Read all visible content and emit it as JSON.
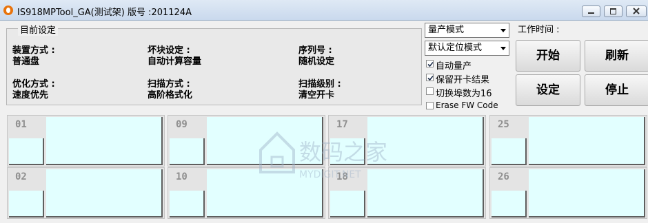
{
  "window": {
    "title": "IS918MPTool_GA(测试架) 版号 :201124A"
  },
  "group": {
    "title": "目前设定",
    "fields": [
      {
        "label": "装置方式 :",
        "value": "普通盘"
      },
      {
        "label": "坏块设定 :",
        "value": "自动计算容量"
      },
      {
        "label": "序列号 :",
        "value": "随机设定"
      },
      {
        "label": "优化方式 :",
        "value": "速度优先"
      },
      {
        "label": "扫描方式 :",
        "value": "高阶格式化"
      },
      {
        "label": "扫描级别 :",
        "value": "清空开卡"
      }
    ]
  },
  "controls": {
    "mode_select": "量产模式",
    "position_select": "默认定位模式",
    "checkboxes": [
      {
        "label": "自动量产",
        "checked": true
      },
      {
        "label": "保留开卡结果",
        "checked": true
      },
      {
        "label": "切换埠数为16",
        "checked": false
      },
      {
        "label": "Erase FW Code",
        "checked": false
      }
    ],
    "work_time_label": "工作时间 :",
    "buttons": {
      "start": "开始",
      "refresh": "刷新",
      "settings": "设定",
      "stop": "停止"
    }
  },
  "slots": [
    "01",
    "02",
    "09",
    "10",
    "17",
    "18",
    "25",
    "26"
  ],
  "watermark": {
    "title": "数码之家",
    "subtitle": "MYDIGIT.NET"
  },
  "colors": {
    "slot_fill": "#e2ffff",
    "app_icon": "#e8730c"
  }
}
